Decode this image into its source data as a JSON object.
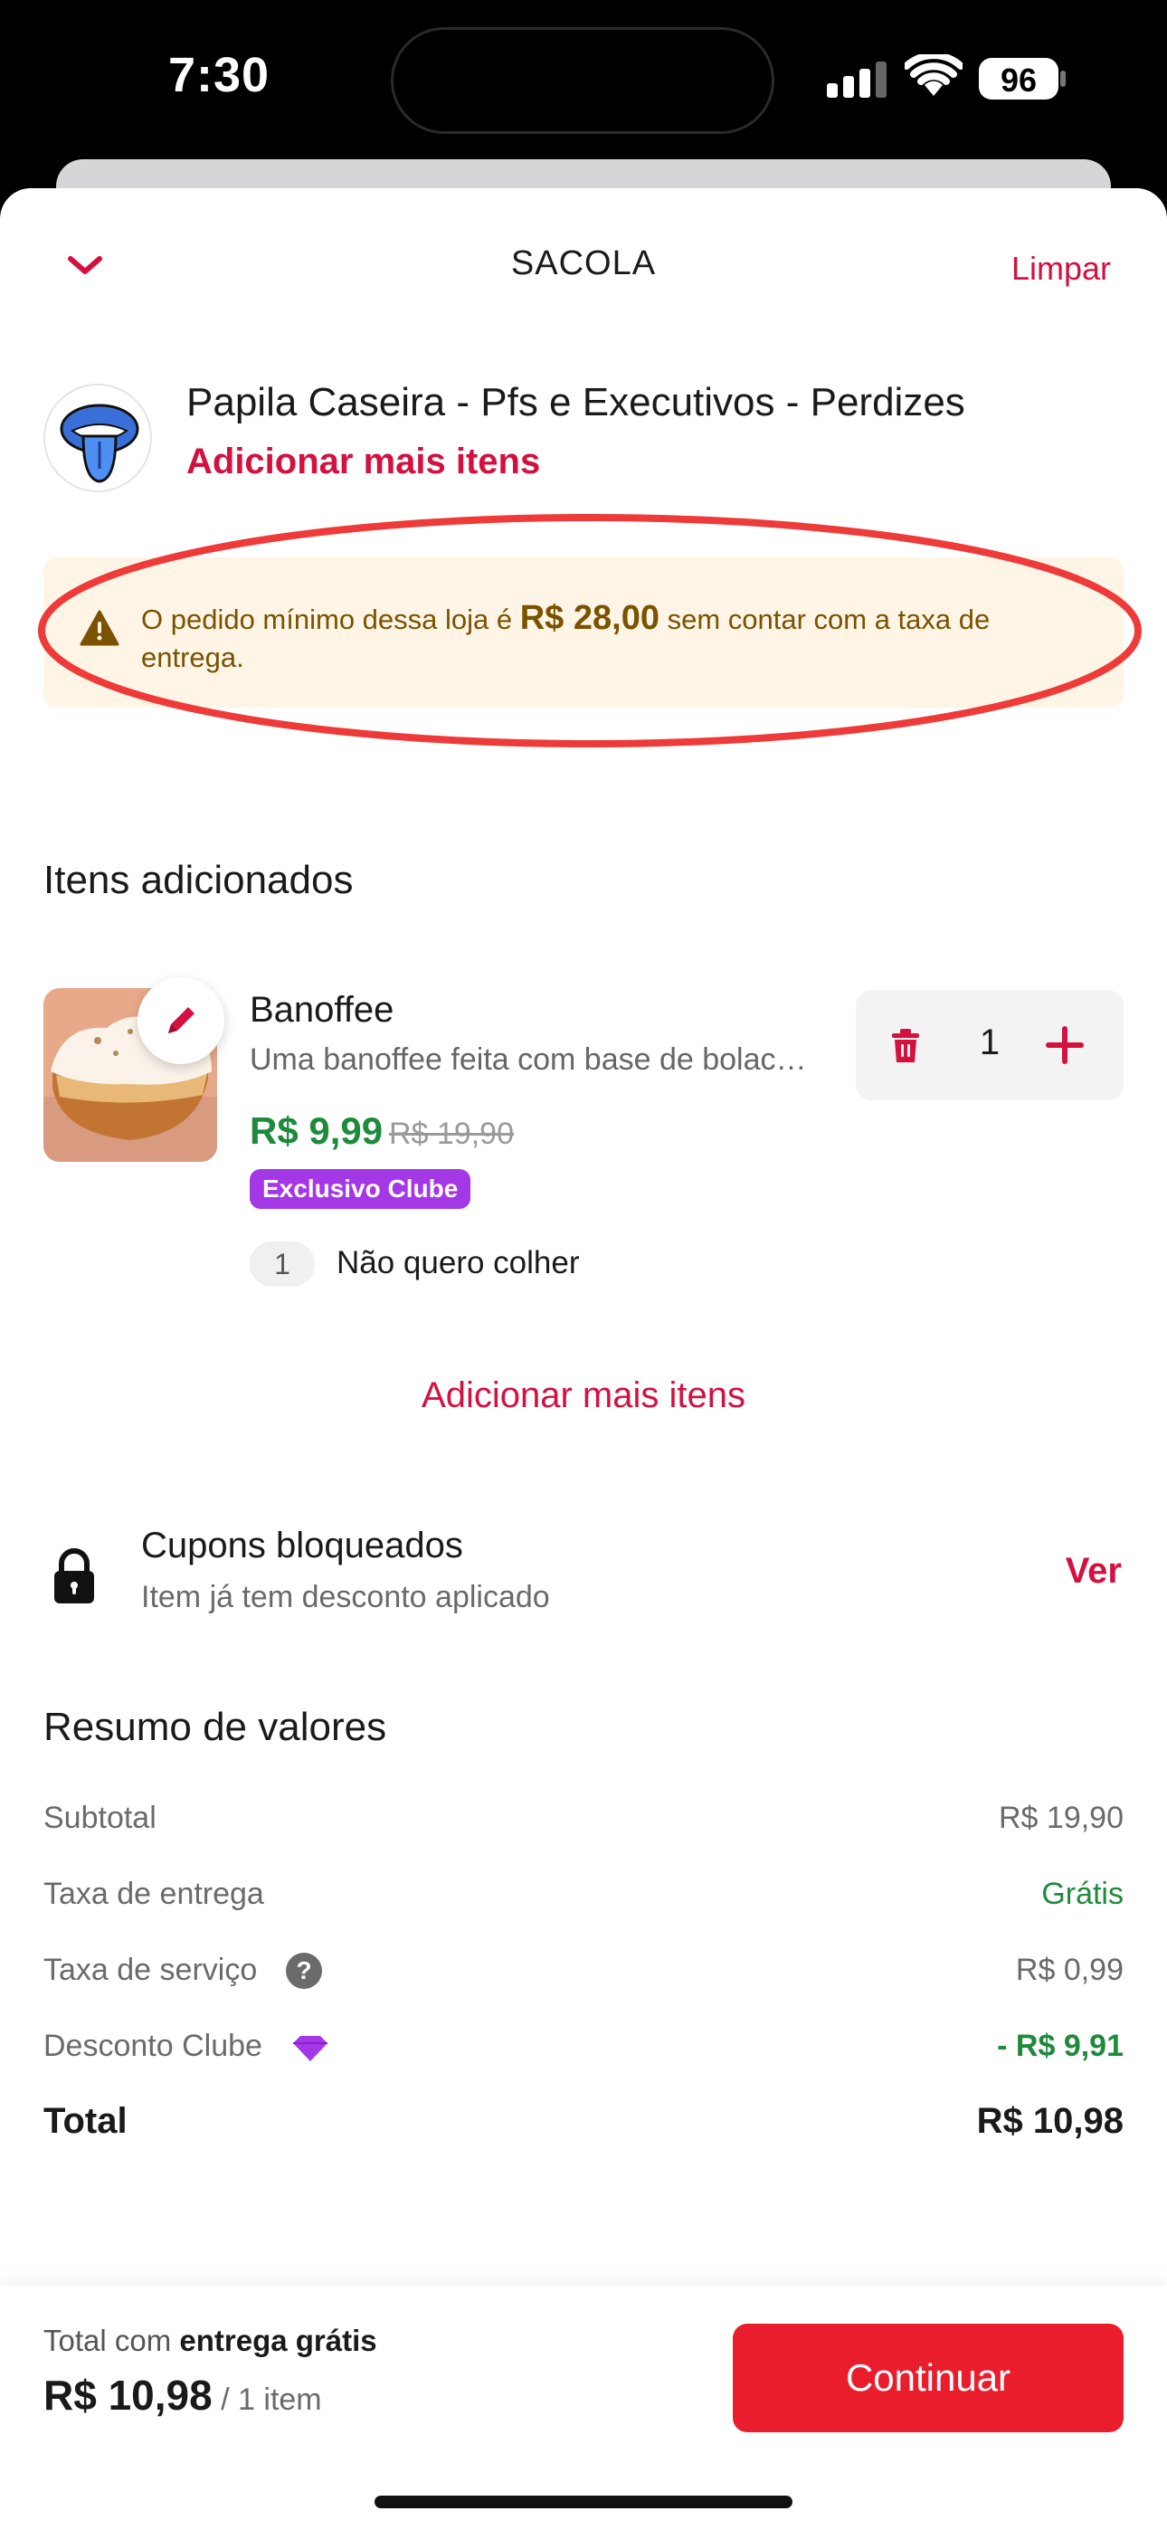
{
  "status_bar": {
    "time": "7:30",
    "battery": "96"
  },
  "header": {
    "title": "SACOLA",
    "clear_label": "Limpar",
    "collapse_icon": "chevron-down-icon"
  },
  "store": {
    "name": "Papila Caseira - Pfs e Executivos - Perdizes",
    "add_more_label": "Adicionar mais itens",
    "logo_icon": "tongue-logo"
  },
  "notice": {
    "text_before": "O pedido mínimo dessa loja é ",
    "amount": "R$ 28,00",
    "text_after": " sem contar com a taxa de entrega.",
    "icon": "warning-icon"
  },
  "items_section": {
    "title": "Itens adicionados",
    "items": [
      {
        "name": "Banoffee",
        "description": "Uma banoffee feita com base de bolacha, doce de leite e banana",
        "price": "R$ 9,99",
        "old_price": "R$ 19,90",
        "badge": "Exclusivo Clube",
        "quantity": "1",
        "options": [
          {
            "qty": "1",
            "label": "Não quero colher"
          }
        ]
      }
    ],
    "add_more_label": "Adicionar mais itens"
  },
  "coupons": {
    "title": "Cupons bloqueados",
    "subtitle": "Item já tem desconto aplicado",
    "action_label": "Ver",
    "icon": "lock-icon"
  },
  "summary": {
    "title": "Resumo de valores",
    "rows": [
      {
        "label": "Subtotal",
        "value": "R$ 19,90"
      },
      {
        "label": "Taxa de entrega",
        "value": "Grátis"
      },
      {
        "label": "Taxa de serviço",
        "value": "R$ 0,99",
        "help": "?"
      },
      {
        "label": "Desconto Clube",
        "value": "- R$ 9,91"
      }
    ],
    "total_label": "Total",
    "total_value": "R$ 10,98"
  },
  "footer": {
    "line_prefix": "Total com ",
    "line_bold": "entrega grátis",
    "total": "R$ 10,98",
    "items_count": " / 1 item",
    "continue_label": "Continuar"
  },
  "colors": {
    "brand_red": "#ea1d2c",
    "link_red": "#d4103f",
    "price_green": "#1e8a3c",
    "club_purple": "#a538e6",
    "notice_bg": "#fff5e6",
    "annotation_red": "#ee3a38"
  }
}
